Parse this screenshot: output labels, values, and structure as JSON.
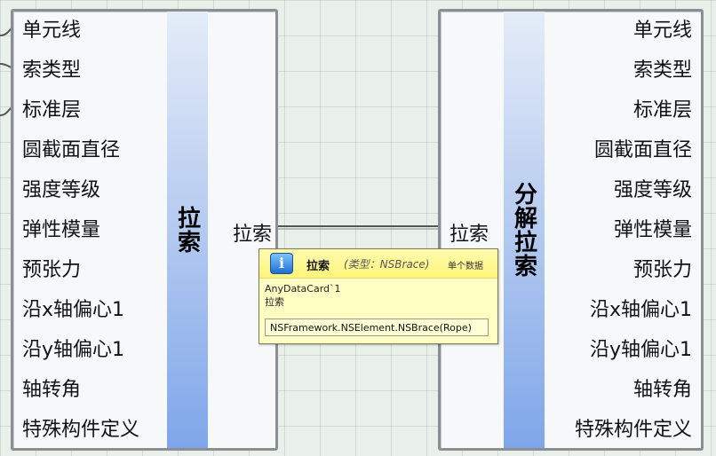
{
  "canvas": {
    "background": "#e9efe9"
  },
  "left_component": {
    "name": "拉索",
    "inputs": [
      "单元线",
      "索类型",
      "标准层",
      "圆截面直径",
      "强度等级",
      "弹性模量",
      "预张力",
      "沿x轴偏心1",
      "沿y轴偏心1",
      "轴转角",
      "特殊构件定义"
    ],
    "output": "拉索",
    "band_color": "#7fa6ea"
  },
  "right_component": {
    "name": "分解拉索",
    "input": "拉索",
    "outputs": [
      "单元线",
      "索类型",
      "标准层",
      "圆截面直径",
      "强度等级",
      "弹性模量",
      "预张力",
      "沿x轴偏心1",
      "沿y轴偏心1",
      "轴转角",
      "特殊构件定义"
    ]
  },
  "tooltip": {
    "icon": "info-icon",
    "title": "拉索",
    "type": "(类型：NSBrace)",
    "access": "单个数据",
    "line1": "AnyDataCard`1",
    "line2": "拉索",
    "value": "NSFramework.NSElement.NSBrace(Rope)"
  }
}
